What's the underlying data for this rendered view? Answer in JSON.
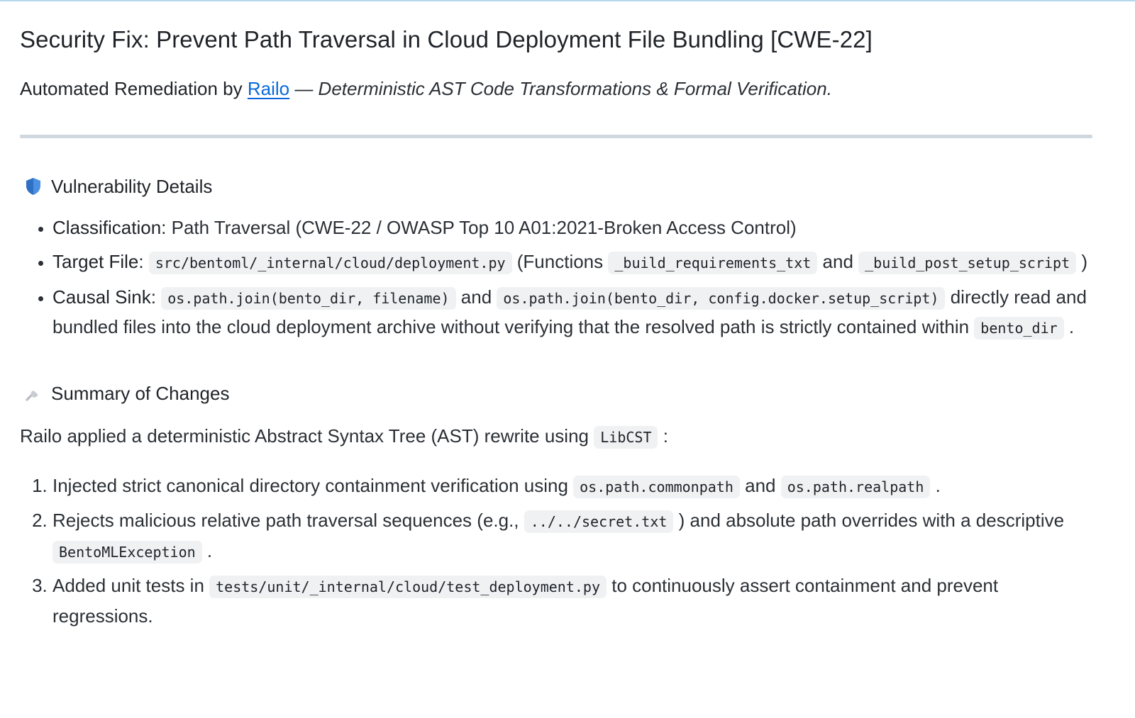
{
  "title": "Security Fix: Prevent Path Traversal in Cloud Deployment File Bundling [CWE-22]",
  "subtitle": {
    "prefix": "Automated Remediation by ",
    "link": "Railo",
    "suffix": " — Deterministic AST Code Transformations & Formal Verification."
  },
  "vulnerability": {
    "heading": "Vulnerability Details",
    "icon": "shield-icon",
    "classification": {
      "label": "Classification:",
      "text": " Path Traversal (CWE-22 / OWASP Top 10 A01:2021-Broken Access Control)"
    },
    "target_file": {
      "label": "Target File:",
      "file": "src/bentoml/_internal/cloud/deployment.py",
      "t1": " (Functions ",
      "fn1": "_build_requirements_txt",
      "t2": " and ",
      "fn2": "_build_post_setup_script",
      "t3": " )"
    },
    "causal_sink": {
      "label": "Causal Sink:",
      "code1": "os.path.join(bento_dir, filename)",
      "t1": " and ",
      "code2": "os.path.join(bento_dir, config.docker.setup_script)",
      "t2": " directly read and bundled files into the cloud deployment archive without verifying that the resolved path is strictly contained within ",
      "code3": "bento_dir",
      "t3": " ."
    }
  },
  "changes": {
    "heading": "Summary of Changes",
    "icon": "wrench-icon",
    "intro_text": "Railo applied a deterministic Abstract Syntax Tree (AST) rewrite using ",
    "intro_code": "LibCST",
    "intro_end": " :",
    "item1": {
      "t1": "Injected strict canonical directory containment verification using ",
      "c1": "os.path.commonpath",
      "t2": " and ",
      "c2": "os.path.realpath",
      "t3": " ."
    },
    "item2": {
      "t1": "Rejects malicious relative path traversal sequences (e.g., ",
      "c1": "../../secret.txt",
      "t2": " ) and absolute path overrides with a descriptive ",
      "c2": "BentoMLException",
      "t3": " ."
    },
    "item3": {
      "t1": "Added unit tests in ",
      "c1": "tests/unit/_internal/cloud/test_deployment.py",
      "t2": " to continuously assert containment and prevent regressions."
    }
  },
  "colors": {
    "link": "#0969da",
    "code_bg": "#eff1f3",
    "divider": "#d0d7de",
    "shield": "#3b82f6"
  }
}
